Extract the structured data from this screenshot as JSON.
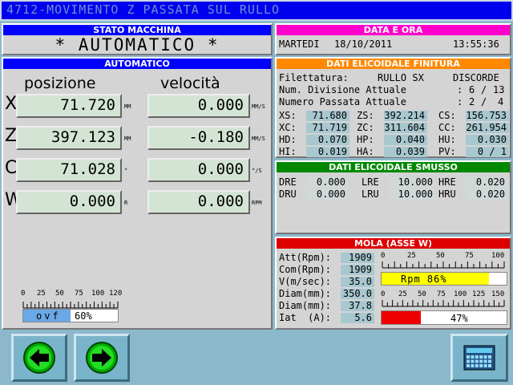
{
  "window": {
    "title": "4712-MOVIMENTO Z PASSATA SUL RULLO"
  },
  "stato": {
    "header": "STATO MACCHINA",
    "mode": "* AUTOMATICO *"
  },
  "datetime": {
    "header": "DATA E ORA",
    "day": "MARTEDI",
    "date": "18/10/2011",
    "time": "13:55:36"
  },
  "auto": {
    "header": "AUTOMATICO",
    "pos_label": "posizione",
    "vel_label": "velocità",
    "axes": [
      {
        "name": "X",
        "pos": "71.720",
        "pos_unit": "MM",
        "vel": "0.000",
        "vel_unit": "MM/S"
      },
      {
        "name": "Z",
        "pos": "397.123",
        "pos_unit": "MM",
        "vel": "-0.180",
        "vel_unit": "MM/S"
      },
      {
        "name": "C",
        "pos": "71.028",
        "pos_unit": "°",
        "vel": "0.000",
        "vel_unit": "°/S"
      },
      {
        "name": "W",
        "pos": "0.000",
        "pos_unit": "R",
        "vel": "0.000",
        "vel_unit": "RPM"
      }
    ],
    "ovf": {
      "ticks": [
        "0",
        "25",
        "50",
        "75",
        "100",
        "120"
      ],
      "label": "ovf",
      "value_text": "60%",
      "value": 60
    }
  },
  "finitura": {
    "header": "DATI ELICOIDALE FINITURA",
    "filettatura_label": "Filettatura:",
    "filettatura_value": "RULLO SX",
    "direction": "DISCORDE",
    "div_label": "Num. Divisione Attuale",
    "div_sep": ":",
    "div_cur": "6",
    "div_tot": "13",
    "pass_label": "Numero Passata Attuale",
    "pass_sep": ":",
    "pass_cur": "2",
    "pass_tot": "4",
    "rows": [
      [
        {
          "l": "XS:",
          "v": "71.680"
        },
        {
          "l": "ZS:",
          "v": "392.214"
        },
        {
          "l": "CS:",
          "v": "156.753"
        }
      ],
      [
        {
          "l": "XC:",
          "v": "71.719"
        },
        {
          "l": "ZC:",
          "v": "311.604"
        },
        {
          "l": "CC:",
          "v": "261.954"
        }
      ],
      [
        {
          "l": "HD:",
          "v": "0.070"
        },
        {
          "l": "HP:",
          "v": "0.040"
        },
        {
          "l": "HU:",
          "v": "0.030"
        }
      ],
      [
        {
          "l": "HI:",
          "v": "0.019"
        },
        {
          "l": "HA:",
          "v": "0.039"
        },
        {
          "l": "PV:",
          "v": "0 / 1"
        }
      ]
    ]
  },
  "smusso": {
    "header": "DATI ELICOIDALE SMUSSO",
    "rows": [
      [
        {
          "l": "DRE",
          "v": "0.000"
        },
        {
          "l": "LRE",
          "v": "10.000"
        },
        {
          "l": "HRE",
          "v": "0.020"
        }
      ],
      [
        {
          "l": "DRU",
          "v": "0.000"
        },
        {
          "l": "LRU",
          "v": "10.000"
        },
        {
          "l": "HRU",
          "v": "0.020"
        }
      ]
    ]
  },
  "mola": {
    "header": "MOLA (ASSE W)",
    "items": [
      {
        "l": "Att(Rpm):",
        "v": "1909"
      },
      {
        "l": "Com(Rpm):",
        "v": "1909"
      },
      {
        "l": "V(m/sec):",
        "v": "35.0"
      },
      {
        "l": "Diam(mm):",
        "v": "350.0"
      },
      {
        "l": "Diam(mm):",
        "v": "37.8"
      },
      {
        "l": "Iat  (A):",
        "v": "5.6"
      }
    ],
    "rpm_ticks": [
      "0",
      "25",
      "50",
      "75",
      "100"
    ],
    "rpm_bar": {
      "text": "Rpm   86%",
      "value": 86,
      "color": "#ffff00"
    },
    "cur_ticks": [
      "0",
      "25",
      "50",
      "75",
      "100",
      "125",
      "150"
    ],
    "cur_bar": {
      "text": "47%",
      "value": 47,
      "color": "#ee0000"
    }
  },
  "buttons": {
    "back": "arrow-left",
    "forward": "arrow-right",
    "keypad": "keypad"
  }
}
